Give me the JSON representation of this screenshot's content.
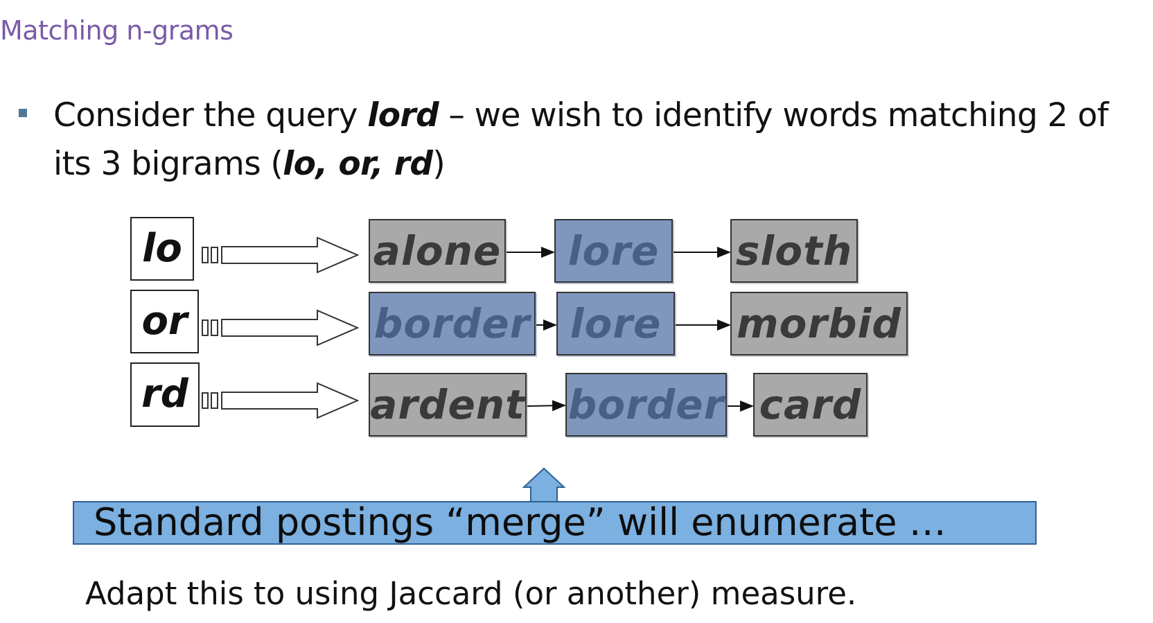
{
  "slide": {
    "title": "Matching n-grams",
    "bullet": {
      "pre": "Consider the query ",
      "query": "lord",
      "mid": " – we wish to identify words matching 2 of its 3 bigrams (",
      "bigrams": "lo, or, rd",
      "post": ")"
    },
    "banner": "Standard postings “merge” will enumerate …",
    "footer": "Adapt this to using Jaccard (or another) measure."
  },
  "diagram": {
    "rows": [
      {
        "key": "lo",
        "postings": [
          {
            "word": "alone",
            "match": false
          },
          {
            "word": "lore",
            "match": true
          },
          {
            "word": "sloth",
            "match": false
          }
        ]
      },
      {
        "key": "or",
        "postings": [
          {
            "word": "border",
            "match": true
          },
          {
            "word": "lore",
            "match": true
          },
          {
            "word": "morbid",
            "match": false
          }
        ]
      },
      {
        "key": "rd",
        "postings": [
          {
            "word": "ardent",
            "match": false
          },
          {
            "word": "border",
            "match": true
          },
          {
            "word": "card",
            "match": false
          }
        ]
      }
    ],
    "colors": {
      "match": "#7f96bd",
      "nonmatch": "#a9a9a9",
      "banner": "#7bb0e0",
      "title": "#7a5aa8"
    }
  }
}
